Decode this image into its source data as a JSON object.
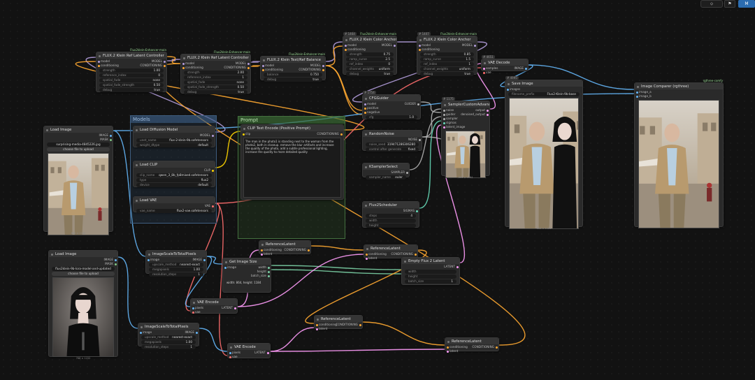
{
  "toolbar": {
    "menu_label": "M",
    "logo_glyph": "⬦",
    "bookmark_glyph": "⚑"
  },
  "groups": {
    "models": "Models",
    "prompt": "Prompt"
  },
  "nodes": {
    "flux_ref_1": {
      "title": "FLUX.2 Klein Ref Latent Controller",
      "badge": "Flux2klein-Enhancer-main",
      "in": [
        "model",
        "conditioning"
      ],
      "out": [
        "MODEL",
        "CONDITIONING"
      ],
      "w": [
        [
          "strength",
          "1.00"
        ],
        [
          "reference_index",
          "0"
        ],
        [
          "spatial_fade",
          "none"
        ],
        [
          "spatial_fade_strength",
          "0.50"
        ],
        [
          "debug",
          "true"
        ]
      ]
    },
    "flux_ref_2": {
      "title": "FLUX.2 Klein Ref Latent Controller",
      "badge": "Flux2klein-Enhancer-main",
      "in": [
        "model",
        "conditioning"
      ],
      "out": [
        "MODEL",
        "CONDITIONING"
      ],
      "w": [
        [
          "strength",
          "2.00"
        ],
        [
          "reference_index",
          "1"
        ],
        [
          "spatial_fade",
          "none"
        ],
        [
          "spatial_fade_strength",
          "0.50"
        ],
        [
          "debug",
          "true"
        ]
      ]
    },
    "flux_text": {
      "title": "FLUX.2 Klein Text/Ref Balance",
      "badge": "Flux2klein-Enhancer-main",
      "in": [
        "model",
        "conditioning"
      ],
      "out": [
        "MODEL",
        "CONDITIONING"
      ],
      "w": [
        [
          "balance",
          "0.750"
        ],
        [
          "debug",
          "true"
        ]
      ]
    },
    "color1": {
      "title": "FLUX.2 Klein Color Anchor",
      "badge": "Flux2klein-Enhancer-main",
      "id": "# 1464",
      "in": [
        "model",
        "conditioning"
      ],
      "out": [
        "MODEL"
      ],
      "w": [
        [
          "strength",
          "0.75"
        ],
        [
          "ramp_curve",
          "2.5"
        ],
        [
          "ref_index",
          "0"
        ],
        [
          "channel_weights",
          "uniform"
        ],
        [
          "debug",
          "true"
        ]
      ]
    },
    "color2": {
      "title": "FLUX.2 Klein Color Anchor",
      "badge": "Flux2klein-Enhancer-main",
      "id": "# 1407",
      "in": [
        "model",
        "conditioning"
      ],
      "out": [
        "MODEL"
      ],
      "w": [
        [
          "strength",
          "0.85"
        ],
        [
          "ramp_curve",
          "1.5"
        ],
        [
          "ref_index",
          "1"
        ],
        [
          "channel_weights",
          "uniform"
        ],
        [
          "debug",
          "true"
        ]
      ]
    },
    "vae_decode": {
      "title": "VAE Decode",
      "id": "# 4651",
      "in": [
        "samples",
        "vae"
      ],
      "out": [
        "IMAGE"
      ]
    },
    "load_image_1": {
      "title": "Load Image",
      "out": [
        "IMAGE",
        "MASK"
      ],
      "file": "surprising-media-4845226.jpg",
      "upload": "choose file to upload",
      "size": "800 × 1120"
    },
    "load_image_2": {
      "title": "Load Image",
      "out": [
        "IMAGE",
        "MASK"
      ],
      "file": "flux2klein-9b-lora-model-and-updated",
      "upload": "choose file to upload",
      "size": "768 × 1152"
    },
    "load_diffusion": {
      "title": "Load Diffusion Model",
      "out": [
        "MODEL"
      ],
      "w": [
        [
          "unet_name",
          "flux-2-klein-9b.safetensors"
        ],
        [
          "weight_dtype",
          "default"
        ]
      ]
    },
    "load_clip": {
      "title": "Load CLIP",
      "out": [
        "CLIP"
      ],
      "w": [
        [
          "clip_name",
          "qwen_3_8b_fp8mixed.safetensors"
        ],
        [
          "type",
          "flux2"
        ],
        [
          "device",
          "default"
        ]
      ]
    },
    "load_vae": {
      "title": "Load VAE",
      "out": [
        "VAE"
      ],
      "w": [
        [
          "vae_name",
          "flux2-vae.safetensors"
        ]
      ]
    },
    "clip_text": {
      "title": "CLIP Text Encode (Positive Prompt)",
      "in": [
        "clip"
      ],
      "out": [
        "CONDITIONING"
      ],
      "text": "The man in the photo1 is standing next to the woman from the photo2, both in closeup. remove the blur artifacts and increase the quality of the photo, add a subtle professional lighting, increase the quality to more detailed quality"
    },
    "cfg_guider": {
      "title": "CFGGuider",
      "id": "# 1754",
      "in": [
        "model",
        "positive",
        "negative"
      ],
      "out": [
        "GUIDER"
      ],
      "w": [
        [
          "cfg",
          "1.0"
        ]
      ]
    },
    "random_noise": {
      "title": "RandomNoise",
      "out": [
        "NOISE"
      ],
      "w": [
        [
          "noise_seed",
          "319471286306280"
        ],
        [
          "control after generate",
          "fixed"
        ]
      ]
    },
    "ksampler_select": {
      "title": "KSamplerSelect",
      "out": [
        "SAMPLER"
      ],
      "w": [
        [
          "sampler_name",
          "euler"
        ]
      ]
    },
    "sampler_custom": {
      "title": "SamplerCustomAdvanced",
      "id": "# 1175",
      "in": [
        "noise",
        "guider",
        "sampler",
        "sigmas",
        "latent_image"
      ],
      "out": [
        "output",
        "denoised_output"
      ],
      "size": "864 × 1184"
    },
    "flux2_scheduler": {
      "title": "Flux2Scheduler",
      "out": [
        "SIGMAS"
      ],
      "w": [
        [
          "steps",
          "4"
        ],
        [
          "width",
          ""
        ],
        [
          "height",
          ""
        ]
      ]
    },
    "save_image": {
      "title": "Save Image",
      "id": "# 4995",
      "in": [
        "images"
      ],
      "w": [
        [
          "filename_prefix",
          "Flux2-Klein-9b-base"
        ]
      ],
      "size": "864 × 1184"
    },
    "image_comparer": {
      "title": "Image Comparer (rgthree)",
      "badge": "rgthree-comfy",
      "in": [
        "image_a",
        "image_b"
      ]
    },
    "scale_1": {
      "title": "ImageScaleToTotalPixels",
      "in": [
        "image"
      ],
      "out": [
        "IMAGE"
      ],
      "w": [
        [
          "upscale_method",
          "nearest-exact"
        ],
        [
          "megapixels",
          "1.00"
        ],
        [
          "resolution_steps",
          "1"
        ]
      ]
    },
    "scale_2": {
      "title": "ImageScaleToTotalPixels",
      "in": [
        "image"
      ],
      "out": [
        "IMAGE"
      ],
      "w": [
        [
          "upscale_method",
          "nearest-exact"
        ],
        [
          "megapixels",
          "1.00"
        ],
        [
          "resolution_steps",
          "1"
        ]
      ]
    },
    "get_image_size": {
      "title": "Get Image Size",
      "in": [
        "image"
      ],
      "out": [
        "width",
        "height",
        "batch_size"
      ],
      "text": "width: 864, height: 1184"
    },
    "ref_latent_1": {
      "title": "ReferenceLatent",
      "in": [
        "conditioning",
        "latent"
      ],
      "out": [
        "CONDITIONING"
      ]
    },
    "ref_latent_2": {
      "title": "ReferenceLatent",
      "in": [
        "conditioning",
        "latent"
      ],
      "out": [
        "CONDITIONING"
      ]
    },
    "ref_latent_3": {
      "title": "ReferenceLatent",
      "in": [
        "conditioning",
        "latent"
      ],
      "out": [
        "CONDITIONING"
      ]
    },
    "ref_latent_4": {
      "title": "ReferenceLatent",
      "in": [
        "conditioning",
        "latent"
      ],
      "out": [
        "CONDITIONING"
      ]
    },
    "vae_encode_1": {
      "title": "VAE Encode",
      "in": [
        "pixels",
        "vae"
      ],
      "out": [
        "LATENT"
      ]
    },
    "vae_encode_2": {
      "title": "VAE Encode",
      "in": [
        "pixels",
        "vae"
      ],
      "out": [
        "LATENT"
      ]
    },
    "empty_latent": {
      "title": "Empty Flux 2 Latent",
      "out": [
        "LATENT"
      ],
      "w": [
        [
          "width",
          ""
        ],
        [
          "height",
          ""
        ],
        [
          "batch_size",
          "1"
        ]
      ]
    }
  },
  "colors": {
    "model": "#b39ddb",
    "cond": "#ffa931",
    "clip": "#ffd500",
    "vae": "#ff6e6e",
    "image": "#64b5f6",
    "latent": "#ff9cf9",
    "mask": "#81c784",
    "noise": "#b0b0b0",
    "sigmas": "#66d9b8"
  }
}
